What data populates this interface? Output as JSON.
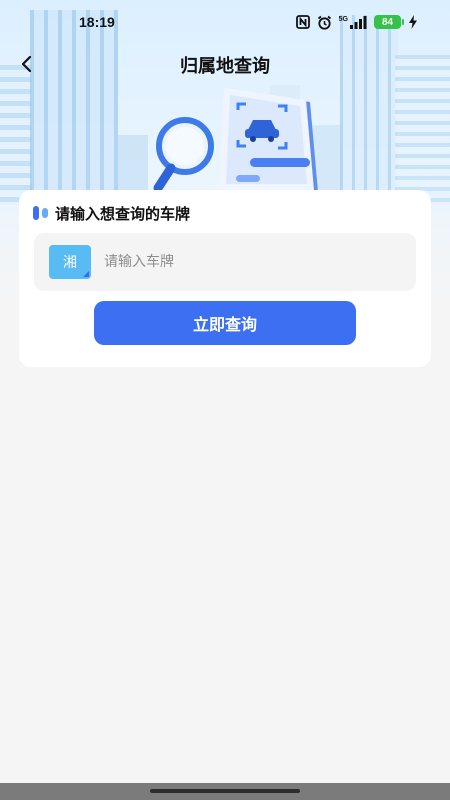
{
  "status_bar": {
    "time": "18:19",
    "network_label": "5G",
    "battery_level": "84",
    "icons": [
      "nfc-icon",
      "alarm-icon",
      "signal-icon",
      "battery-icon",
      "charging-icon"
    ]
  },
  "nav": {
    "title": "归属地查询",
    "back_icon": "chevron-left-icon"
  },
  "card": {
    "title": "请输入想查询的车牌",
    "province_code": "湘",
    "plate_input": {
      "value": "",
      "placeholder": "请输入车牌"
    },
    "submit_label": "立即查询"
  },
  "colors": {
    "primary": "#3d6ff3",
    "province_badge": "#58bbf3",
    "page_background": "#f5f5f5",
    "battery": "#35c24a"
  }
}
